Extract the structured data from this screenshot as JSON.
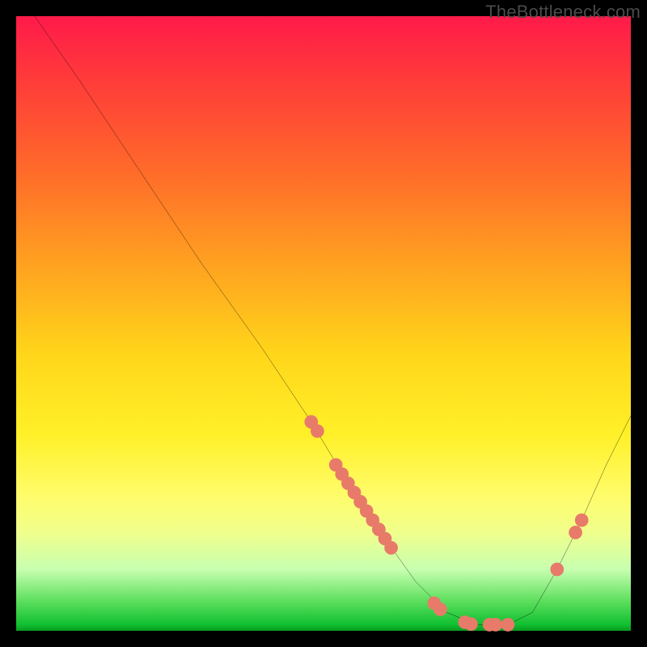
{
  "watermark": "TheBottleneck.com",
  "chart_data": {
    "type": "line",
    "title": "",
    "xlabel": "",
    "ylabel": "",
    "xlim": [
      0,
      100
    ],
    "ylim": [
      0,
      100
    ],
    "curve": {
      "name": "bottleneck-curve",
      "points": [
        {
          "x": 3,
          "y": 100
        },
        {
          "x": 10,
          "y": 90
        },
        {
          "x": 20,
          "y": 75
        },
        {
          "x": 30,
          "y": 60
        },
        {
          "x": 40,
          "y": 46
        },
        {
          "x": 48,
          "y": 34
        },
        {
          "x": 54,
          "y": 24
        },
        {
          "x": 60,
          "y": 15
        },
        {
          "x": 65,
          "y": 8
        },
        {
          "x": 70,
          "y": 3
        },
        {
          "x": 75,
          "y": 1
        },
        {
          "x": 80,
          "y": 1
        },
        {
          "x": 84,
          "y": 3
        },
        {
          "x": 88,
          "y": 10
        },
        {
          "x": 92,
          "y": 18
        },
        {
          "x": 96,
          "y": 27
        },
        {
          "x": 100,
          "y": 35
        }
      ]
    },
    "markers": {
      "name": "data-dots",
      "color": "#e87a6a",
      "points": [
        {
          "x": 48,
          "y": 34
        },
        {
          "x": 49,
          "y": 32.5
        },
        {
          "x": 52,
          "y": 27
        },
        {
          "x": 53,
          "y": 25.5
        },
        {
          "x": 54,
          "y": 24
        },
        {
          "x": 55,
          "y": 22.5
        },
        {
          "x": 56,
          "y": 21
        },
        {
          "x": 57,
          "y": 19.5
        },
        {
          "x": 58,
          "y": 18
        },
        {
          "x": 59,
          "y": 16.5
        },
        {
          "x": 60,
          "y": 15
        },
        {
          "x": 61,
          "y": 13.5
        },
        {
          "x": 68,
          "y": 4.5
        },
        {
          "x": 69,
          "y": 3.5
        },
        {
          "x": 73,
          "y": 1.4
        },
        {
          "x": 74,
          "y": 1.1
        },
        {
          "x": 77,
          "y": 1
        },
        {
          "x": 78,
          "y": 1
        },
        {
          "x": 80,
          "y": 1
        },
        {
          "x": 88,
          "y": 10
        },
        {
          "x": 91,
          "y": 16
        },
        {
          "x": 92,
          "y": 18
        }
      ]
    }
  }
}
